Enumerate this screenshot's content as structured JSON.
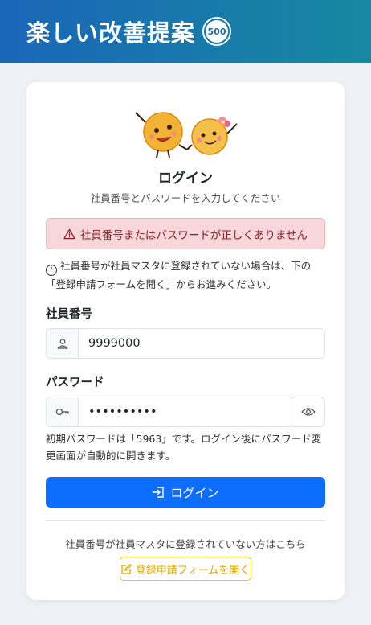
{
  "header": {
    "title": "楽しい改善提案",
    "badge": "500",
    "gradient_start": "#1a66b8",
    "gradient_end": "#1689a0"
  },
  "login": {
    "title": "ログイン",
    "subtitle": "社員番号とパスワードを入力してください",
    "alert": "社員番号またはパスワードが正しくありません",
    "info_note": "社員番号が社員マスタに登録されていない場合は、下の「登録申請フォームを開く」からお進みください。",
    "employee_label": "社員番号",
    "employee_value": "9999000",
    "password_label": "パスワード",
    "password_value": "••••••••••",
    "password_hint": "初期パスワードは「5963」です。ログイン後にパスワード変更画面が自動的に開きます。",
    "login_button": "ログイン",
    "register_note": "社員番号が社員マスタに登録されていない方はこちら",
    "register_button": "登録申請フォームを開く"
  },
  "icons": {
    "alert": "warning-triangle-icon",
    "info": "info-circle-icon",
    "user": "person-icon",
    "key": "key-icon",
    "eye": "eye-icon",
    "login": "login-arrow-icon",
    "edit": "edit-icon"
  },
  "colors": {
    "primary": "#0d6efd",
    "alert_bg": "#f8d7da",
    "alert_text": "#842029",
    "warning": "#ffc107"
  }
}
